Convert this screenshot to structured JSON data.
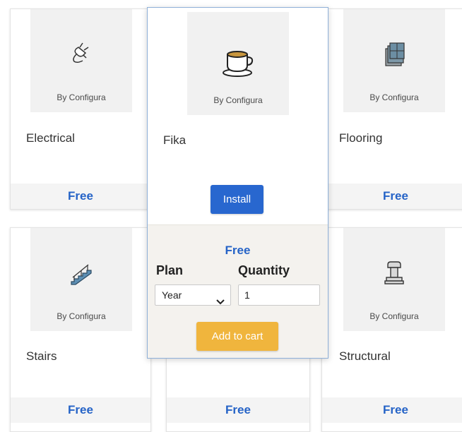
{
  "products": [
    {
      "name": "Electrical",
      "vendor": "By Configura",
      "price": "Free",
      "icon": "plug-icon"
    },
    {
      "name": "Flooring",
      "vendor": "By Configura",
      "price": "Free",
      "icon": "flooring-tiles-icon"
    },
    {
      "name": "Stairs",
      "vendor": "By Configura",
      "price": "Free",
      "icon": "stairs-icon"
    },
    {
      "name": "",
      "vendor": "",
      "price": "Free",
      "icon": ""
    },
    {
      "name": "Structural",
      "vendor": "By Configura",
      "price": "Free",
      "icon": "column-icon"
    }
  ],
  "popup": {
    "name": "Fika",
    "vendor": "By Configura",
    "icon": "coffee-cup-icon",
    "install_label": "Install",
    "price": "Free",
    "plan_label": "Plan",
    "plan_value": "Year",
    "quantity_label": "Quantity",
    "quantity_value": "1",
    "add_to_cart_label": "Add to cart"
  },
  "colors": {
    "accent_blue": "#2867cf",
    "price_blue": "#2563c7",
    "cart_orange": "#f0b53d"
  }
}
